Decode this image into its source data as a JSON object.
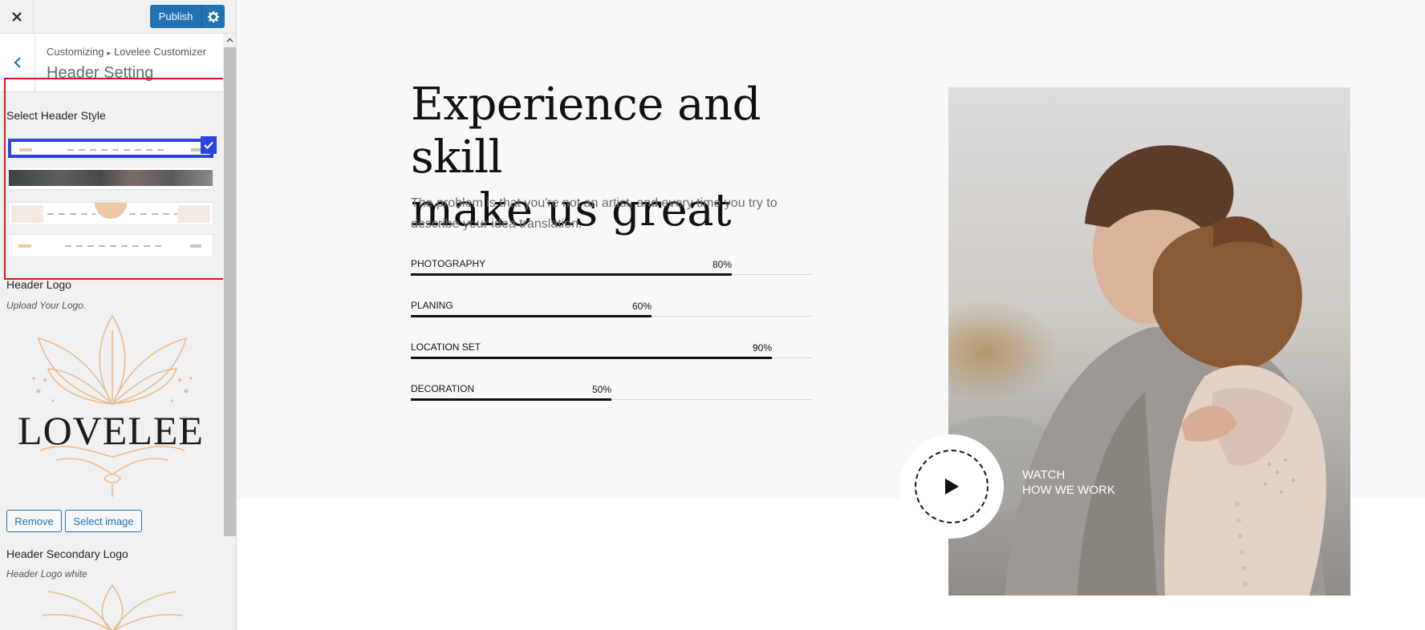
{
  "colors": {
    "accent": "#2271b1",
    "highlight": "#e0141e",
    "selected": "#2a45e0",
    "logo_gold": "#e9bc8c"
  },
  "topbar": {
    "close_icon": "close-icon",
    "publish_label": "Publish",
    "settings_icon": "gear-icon"
  },
  "section": {
    "breadcrumb_root": "Customizing",
    "breadcrumb_parent": "Lovelee Customizer",
    "title": "Header Setting"
  },
  "header_style": {
    "label": "Select Header Style",
    "options": [
      "header-style-1",
      "header-style-2",
      "header-style-3",
      "header-style-4"
    ],
    "selected": "header-style-1"
  },
  "header_logo": {
    "label": "Header Logo",
    "description": "Upload Your Logo.",
    "logo_text": "LOVELEE",
    "remove_label": "Remove",
    "select_label": "Select image"
  },
  "secondary_logo": {
    "label": "Header Secondary Logo",
    "description": "Header Logo white"
  },
  "preview": {
    "title": "Experience and skill\nmake us great",
    "text": "The problem is that you're not an artist, and every time you try to describe your idea translation.",
    "skills": [
      {
        "name": "PHOTOGRAPHY",
        "percent": 80,
        "label": "80%"
      },
      {
        "name": "PLANING",
        "percent": 60,
        "label": "60%"
      },
      {
        "name": "LOCATION SET",
        "percent": 90,
        "label": "90%"
      },
      {
        "name": "DECORATION",
        "percent": 50,
        "label": "50%"
      }
    ],
    "watch_text": "WATCH\nHOW WE WORK"
  }
}
